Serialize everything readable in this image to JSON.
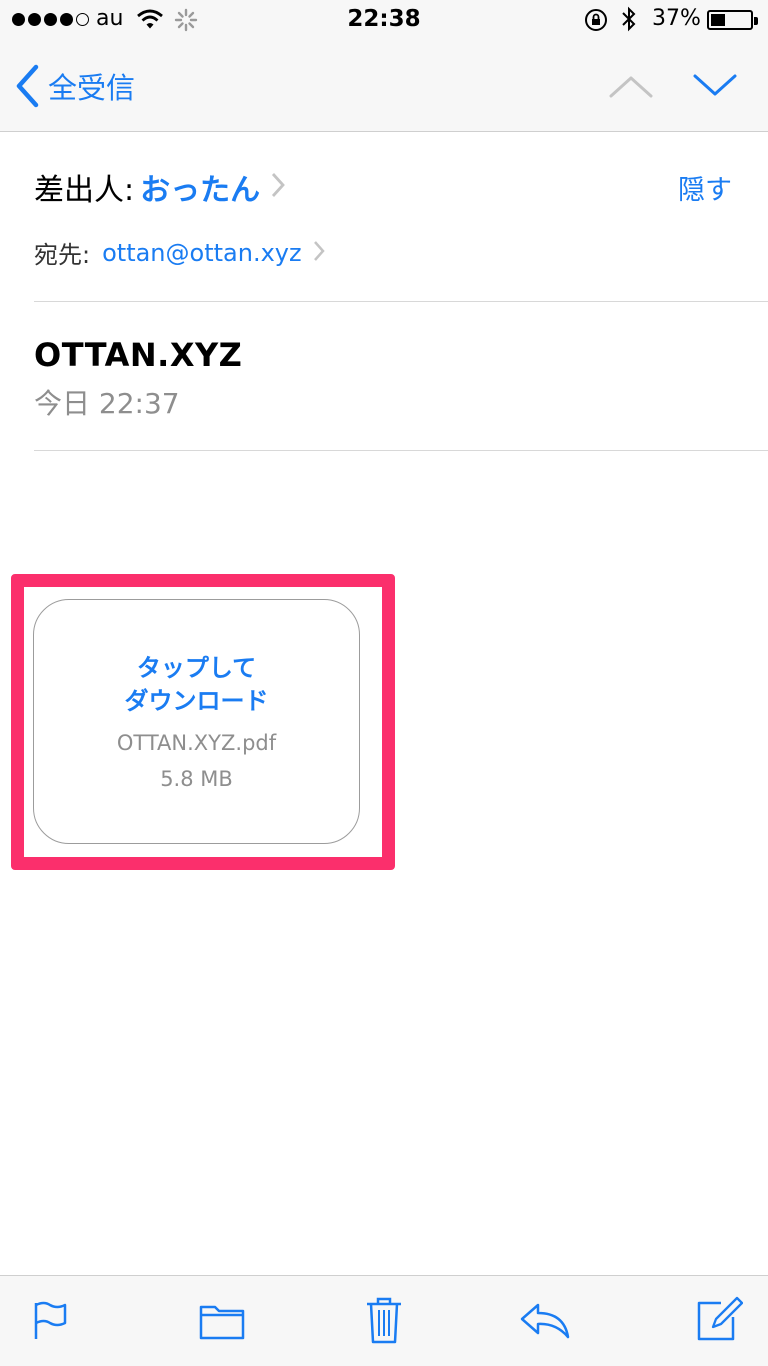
{
  "status_bar": {
    "carrier": "au",
    "time": "22:38",
    "battery_percent": "37%",
    "bluetooth": "✱"
  },
  "nav": {
    "back_label": "全受信"
  },
  "header": {
    "from_label": "差出人:",
    "from_name": "おったん",
    "to_label": "宛先:",
    "to_address": "ottan@ottan.xyz",
    "hide_label": "隠す"
  },
  "message": {
    "subject": "OTTAN.XYZ",
    "date": "今日 22:37"
  },
  "attachment": {
    "tap_line1": "タップして",
    "tap_line2": "ダウンロード",
    "filename": "OTTAN.XYZ.pdf",
    "size": "5.8 MB"
  },
  "toolbar": {
    "icons": [
      "flag-icon",
      "folder-icon",
      "trash-icon",
      "reply-icon",
      "compose-icon"
    ]
  },
  "colors": {
    "accent": "#1a7cf2",
    "highlight": "#fb2f6c",
    "secondary_text": "#8e8e8e"
  }
}
